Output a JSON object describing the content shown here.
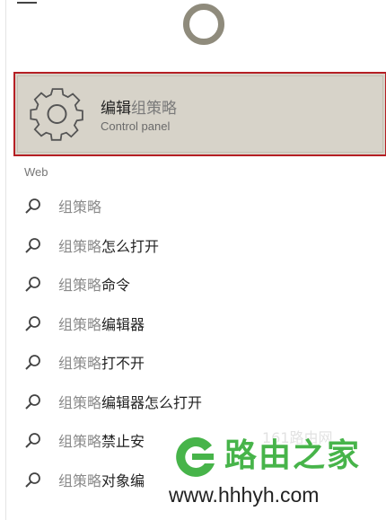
{
  "best_match": {
    "title_highlight": "编辑",
    "title_rest": "组策略",
    "subtitle": "Control panel",
    "icon": "gear-icon"
  },
  "section_web": "Web",
  "results": [
    {
      "query": "组策略",
      "suggest": ""
    },
    {
      "query": "组策略",
      "suggest": "怎么打开"
    },
    {
      "query": "组策略",
      "suggest": "命令"
    },
    {
      "query": "组策略",
      "suggest": "编辑器"
    },
    {
      "query": "组策略",
      "suggest": "打不开"
    },
    {
      "query": "组策略",
      "suggest": "编辑器怎么打开"
    },
    {
      "query": "组策略",
      "suggest": "禁止安"
    },
    {
      "query": "组策略",
      "suggest": "对象编"
    }
  ],
  "watermark": {
    "brand": "路由之家",
    "url": "www.hhhyh.com",
    "faint": "161路由网"
  },
  "colors": {
    "selection_border": "#b51f24",
    "selection_bg": "#d7d3c9",
    "cortana_ring": "#8f8b7c",
    "watermark_green": "#47b44a"
  }
}
